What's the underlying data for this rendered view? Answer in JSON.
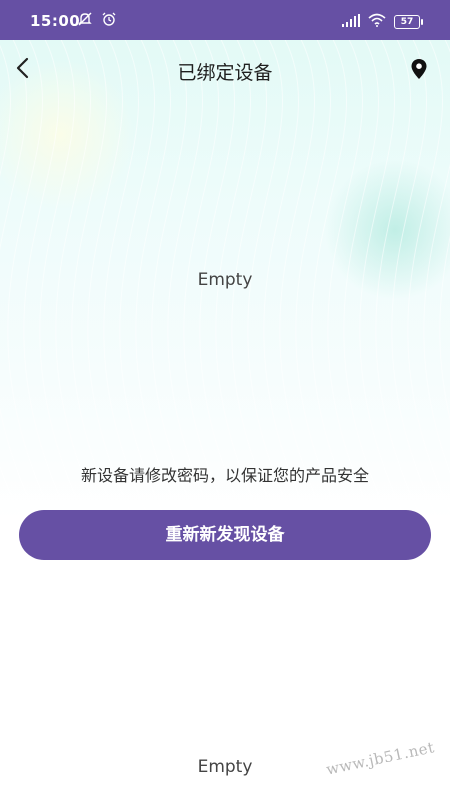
{
  "status_bar": {
    "time": "15:00",
    "battery": "57",
    "icons": [
      "mute-icon",
      "alarm-icon",
      "signal-icon",
      "wifi-icon",
      "battery-icon"
    ]
  },
  "header": {
    "title": "已绑定设备",
    "back_icon": "chevron-left-icon",
    "location_icon": "location-pin-icon"
  },
  "main": {
    "empty_text_top": "Empty",
    "hint": "新设备请修改密码，以保证您的产品安全",
    "rediscover_button": "重新新发现设备",
    "empty_text_bottom": "Empty"
  },
  "watermark": "www.jb51.net",
  "colors": {
    "accent": "#6650a4",
    "hero_top": "#e3faf6",
    "text": "#1f1f1f"
  }
}
